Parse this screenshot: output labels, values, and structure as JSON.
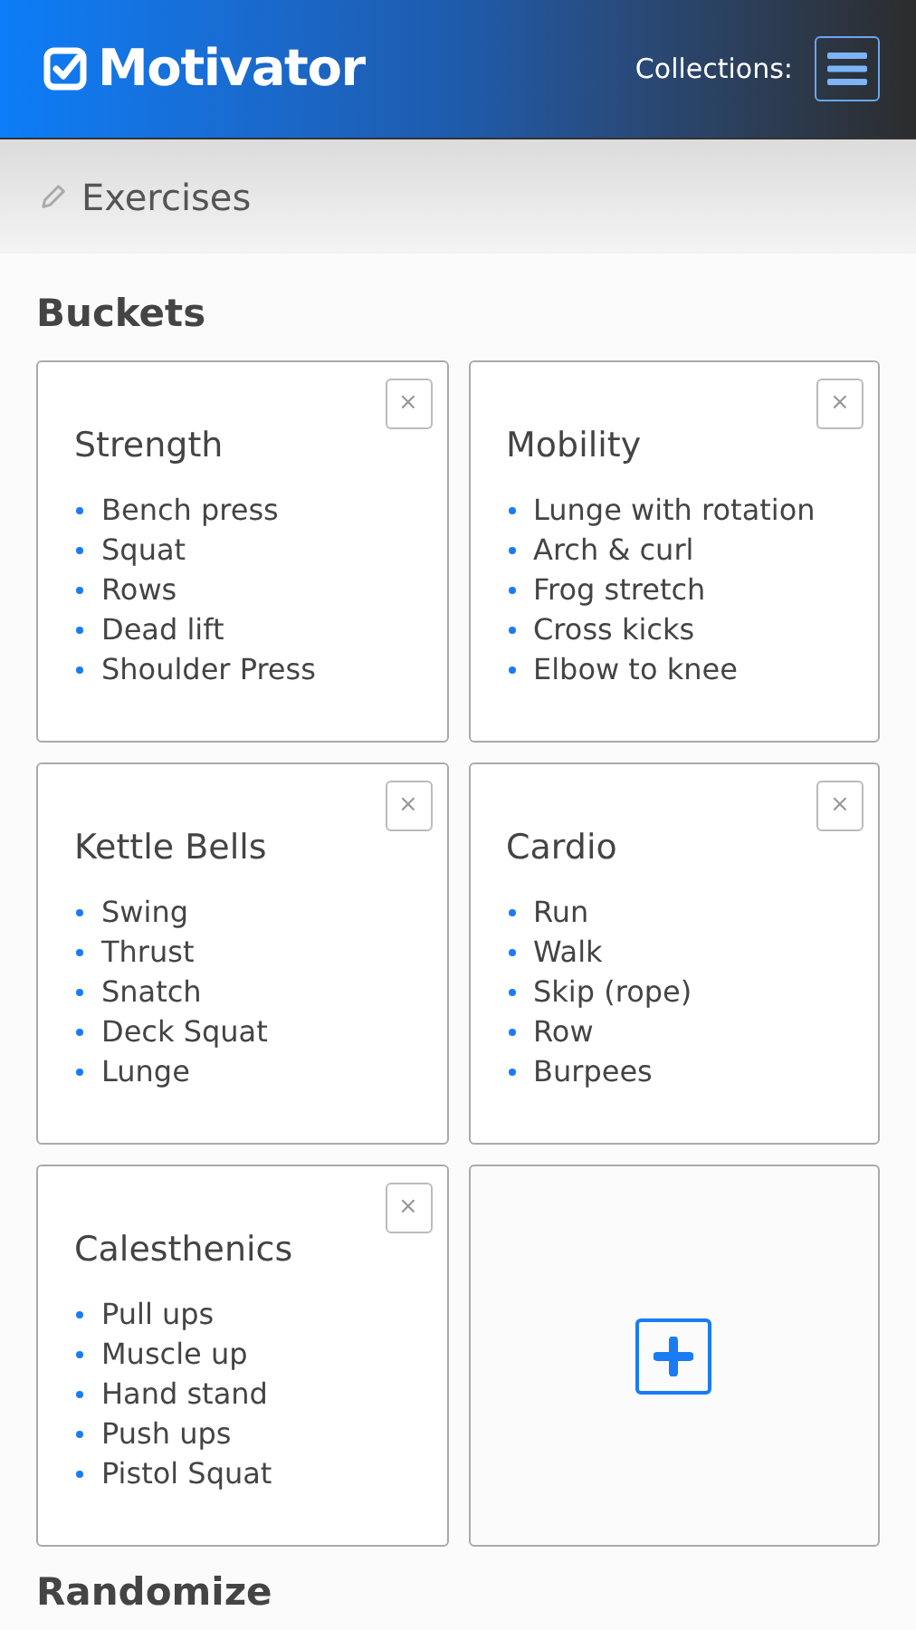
{
  "header": {
    "logo": "Motivator",
    "collections_label": "Collections:"
  },
  "breadcrumb": {
    "title": "Exercises"
  },
  "buckets": {
    "heading": "Buckets",
    "close_symbol": "×",
    "items": [
      {
        "title": "Strength",
        "exercises": [
          "Bench press",
          "Squat",
          "Rows",
          "Dead lift",
          "Shoulder Press"
        ]
      },
      {
        "title": "Mobility",
        "exercises": [
          "Lunge with rotation",
          "Arch & curl",
          "Frog stretch",
          "Cross kicks",
          "Elbow to knee"
        ]
      },
      {
        "title": "Kettle Bells",
        "exercises": [
          "Swing",
          "Thrust",
          "Snatch",
          "Deck Squat",
          "Lunge"
        ]
      },
      {
        "title": "Cardio",
        "exercises": [
          "Run",
          "Walk",
          "Skip (rope)",
          "Row",
          "Burpees"
        ]
      },
      {
        "title": "Calesthenics",
        "exercises": [
          "Pull ups",
          "Muscle up",
          "Hand stand",
          "Push ups",
          "Pistol Squat"
        ]
      }
    ]
  },
  "randomize": {
    "heading": "Randomize"
  }
}
